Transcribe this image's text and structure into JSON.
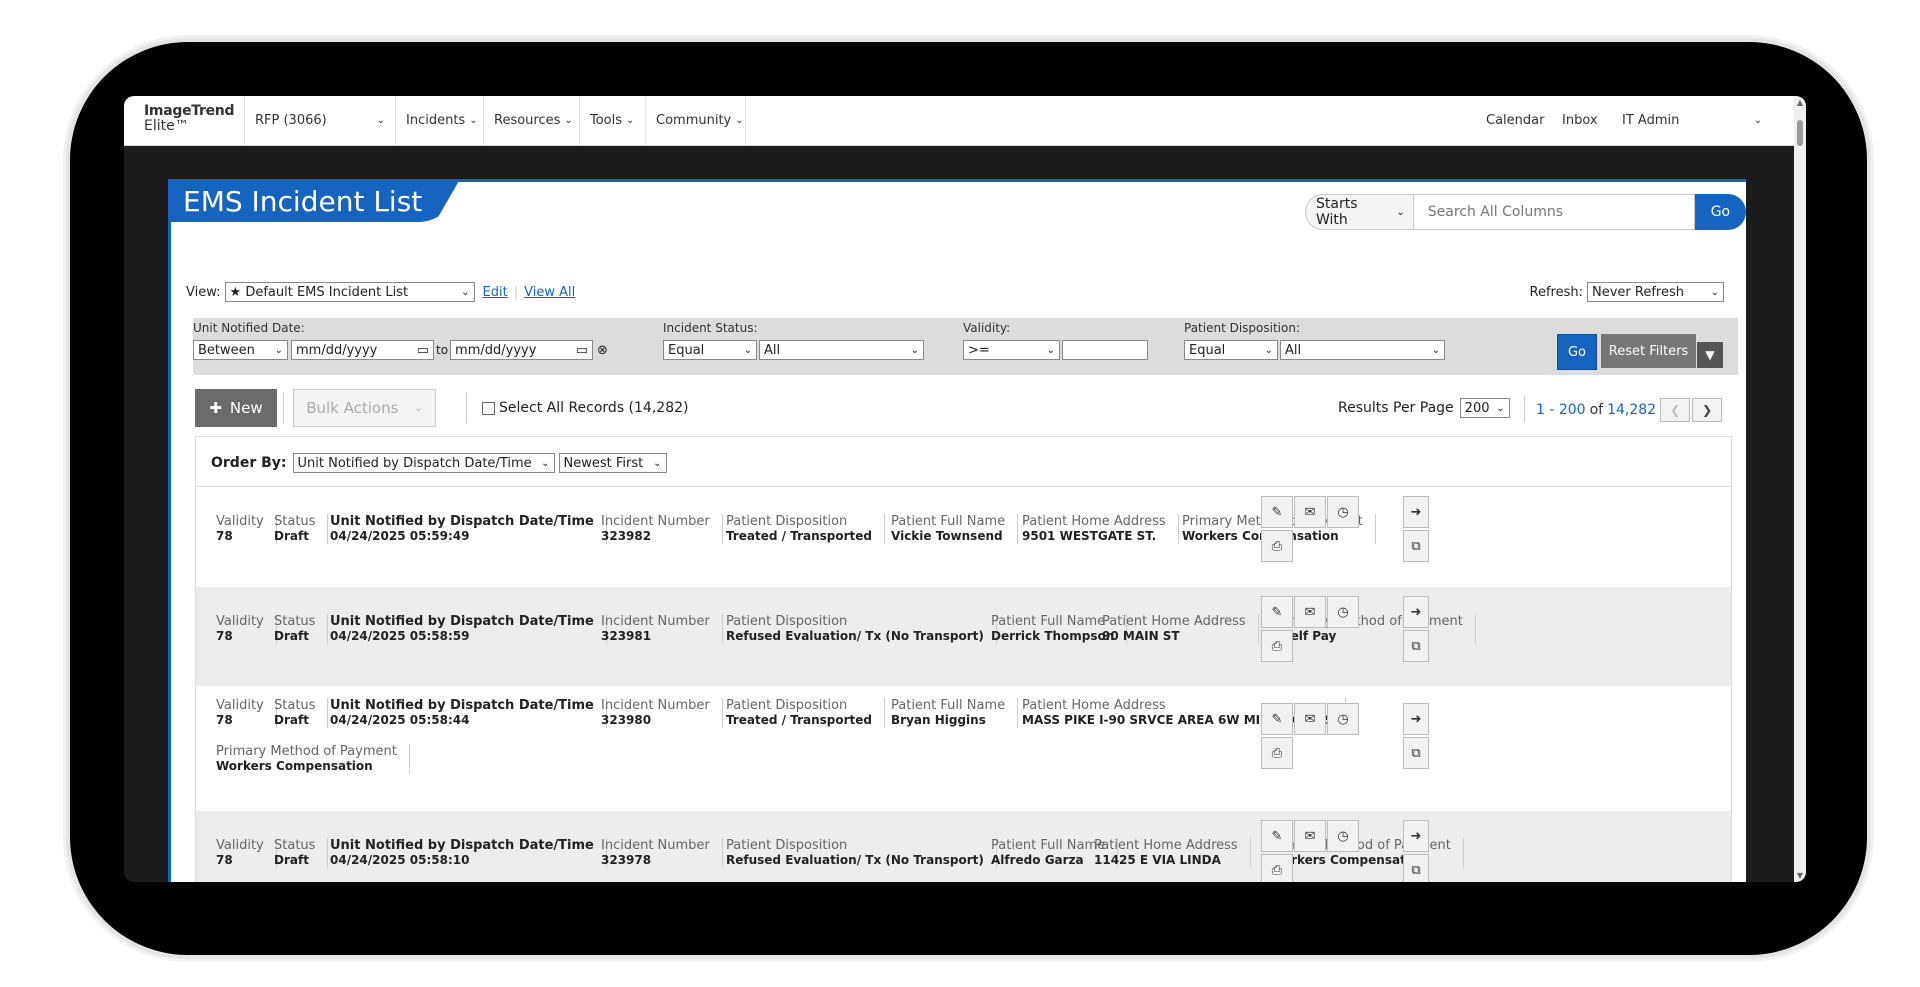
{
  "nav": {
    "logo_line1": "ImageTrend",
    "logo_line2": "Elite™",
    "agency": "RFP (3066)",
    "items": [
      "Incidents",
      "Resources",
      "Tools",
      "Community"
    ],
    "right": [
      "Calendar",
      "Inbox",
      "IT Admin"
    ]
  },
  "page": {
    "title": "EMS Incident List",
    "search_mode": "Starts With",
    "search_placeholder": "Search All Columns",
    "search_go": "Go"
  },
  "view": {
    "label": "View:",
    "selected": "Default EMS Incident List",
    "edit": "Edit",
    "view_all": "View All",
    "refresh_label": "Refresh:",
    "refresh_value": "Never Refresh"
  },
  "filters": {
    "unit_notified_label": "Unit Notified Date:",
    "date_op": "Between",
    "date_from": "mm/dd/yyyy",
    "to": "to",
    "date_to": "mm/dd/yyyy",
    "incident_status_label": "Incident Status:",
    "status_op": "Equal",
    "status_value": "All",
    "validity_label": "Validity:",
    "validity_op": ">=",
    "validity_value": "",
    "disposition_label": "Patient Disposition:",
    "disposition_op": "Equal",
    "disposition_value": "All",
    "go": "Go",
    "reset": "Reset Filters"
  },
  "actions": {
    "new": "New",
    "bulk": "Bulk Actions",
    "select_all": "Select All Records (14,282)",
    "results_per_page_label": "Results Per Page",
    "results_per_page": "200",
    "range": "1 - 200",
    "of": "of",
    "total": "14,282"
  },
  "order": {
    "label": "Order By:",
    "field": "Unit Notified by Dispatch Date/Time",
    "direction": "Newest First"
  },
  "headers": {
    "validity": "Validity",
    "status": "Status",
    "unit_notified": "Unit Notified by Dispatch Date/Time",
    "incident_number": "Incident Number",
    "disposition": "Patient Disposition",
    "name": "Patient Full Name",
    "address": "Patient Home Address",
    "payment": "Primary Method of Payment"
  },
  "records": [
    {
      "validity": "78",
      "status": "Draft",
      "datetime": "04/24/2025 05:59:49",
      "incident": "323982",
      "disposition": "Treated / Transported",
      "name": "Vickie Townsend",
      "address": "9501 WESTGATE ST.",
      "payment": "Workers Compensation"
    },
    {
      "validity": "78",
      "status": "Draft",
      "datetime": "04/24/2025 05:58:59",
      "incident": "323981",
      "disposition": "Refused Evaluation/ Tx (No Transport)",
      "name": "Derrick Thompson",
      "address": "90 MAIN ST",
      "payment": "Self Pay"
    },
    {
      "validity": "78",
      "status": "Draft",
      "datetime": "04/24/2025 05:58:44",
      "incident": "323980",
      "disposition": "Treated / Transported",
      "name": "Bryan Higgins",
      "address": "MASS PIKE I-90 SRVCE AREA 6W MILEPOST 89",
      "payment": "Workers Compensation"
    },
    {
      "validity": "78",
      "status": "Draft",
      "datetime": "04/24/2025 05:58:10",
      "incident": "323978",
      "disposition": "Refused Evaluation/ Tx (No Transport)",
      "name": "Alfredo Garza",
      "address": "11425 E VIA LINDA",
      "payment": "Workers Compensation"
    }
  ]
}
